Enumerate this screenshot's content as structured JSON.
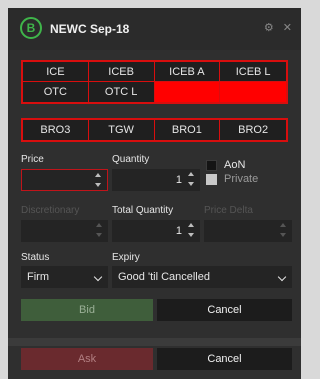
{
  "header": {
    "badge": "B",
    "title": "NEWC Sep-18",
    "icons": [
      "gear-icon",
      "close-icon"
    ],
    "gear_glyph": "⚙",
    "close_glyph": "✕"
  },
  "venues": [
    {
      "label": "ICE"
    },
    {
      "label": "ICEB"
    },
    {
      "label": "ICEB A"
    },
    {
      "label": "ICEB L"
    },
    {
      "label": "OTC"
    },
    {
      "label": "OTC L"
    }
  ],
  "brokers": [
    {
      "label": "BRO3"
    },
    {
      "label": "TGW"
    },
    {
      "label": "BRO1"
    },
    {
      "label": "BRO2"
    }
  ],
  "form": {
    "price_label": "Price",
    "price_value": "",
    "quantity_label": "Quantity",
    "quantity_value": "1",
    "aon_label": "AoN",
    "private_label": "Private",
    "discretionary_label": "Discretionary",
    "discretionary_value": "",
    "total_quantity_label": "Total Quantity",
    "total_quantity_value": "1",
    "price_delta_label": "Price Delta",
    "price_delta_value": "",
    "status_label": "Status",
    "status_value": "Firm",
    "expiry_label": "Expiry",
    "expiry_value": "Good 'til Cancelled"
  },
  "actions": {
    "bid_label": "Bid",
    "cancel_label": "Cancel",
    "ask_label": "Ask",
    "cancel2_label": "Cancel"
  },
  "colors": {
    "accent_green": "#3fb54a",
    "venue_red": "#ff0000",
    "panel_bg": "#2f2f2f"
  }
}
